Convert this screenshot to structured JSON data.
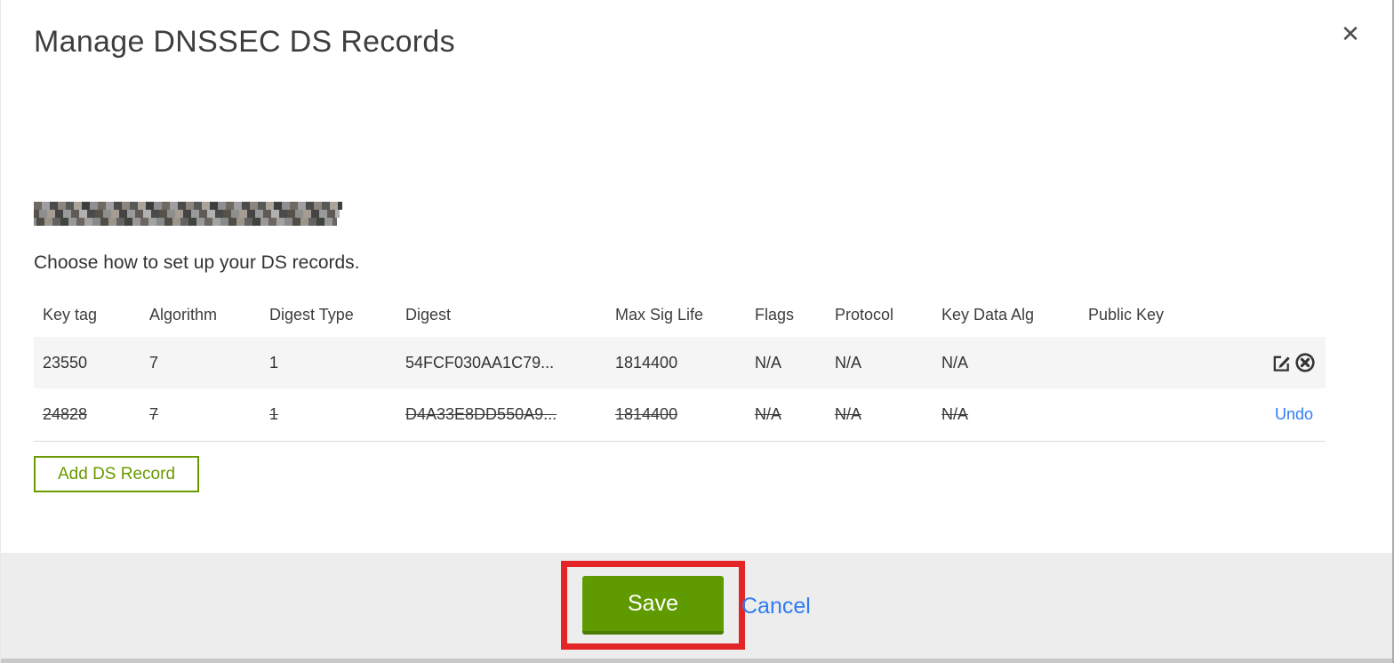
{
  "modal": {
    "title": "Manage DNSSEC DS Records",
    "close_glyph": "✕",
    "instruction": "Choose how to set up your DS records.",
    "domain_label": "(redacted domain name)",
    "table": {
      "headers": [
        "Key tag",
        "Algorithm",
        "Digest Type",
        "Digest",
        "Max Sig Life",
        "Flags",
        "Protocol",
        "Key Data Alg",
        "Public Key"
      ],
      "rows": [
        {
          "key_tag": "23550",
          "algorithm": "7",
          "digest_type": "1",
          "digest": "54FCF030AA1C79...",
          "max_sig_life": "1814400",
          "flags": "N/A",
          "protocol": "N/A",
          "key_data_alg": "N/A",
          "public_key": "",
          "state": "normal",
          "actions": [
            "edit-icon",
            "delete-icon"
          ]
        },
        {
          "key_tag": "24828",
          "algorithm": "7",
          "digest_type": "1",
          "digest": "D4A33E8DD550A9...",
          "max_sig_life": "1814400",
          "flags": "N/A",
          "protocol": "N/A",
          "key_data_alg": "N/A",
          "public_key": "",
          "state": "deleted",
          "undo_label": "Undo"
        }
      ]
    },
    "add_button_label": "Add DS Record",
    "footer": {
      "save_label": "Save",
      "cancel_label": "Cancel"
    },
    "annotation": {
      "type": "highlight-box",
      "target": "save-button",
      "color": "#e42528"
    },
    "colors": {
      "button_green": "#699a00",
      "save_green": "#5f9b00",
      "save_green_dark": "#4b7c00",
      "link_blue": "#2f7cf2",
      "annotation_red": "#e42528",
      "row_stripe": "#f5f5f6",
      "footer_bg": "#ededee"
    }
  }
}
